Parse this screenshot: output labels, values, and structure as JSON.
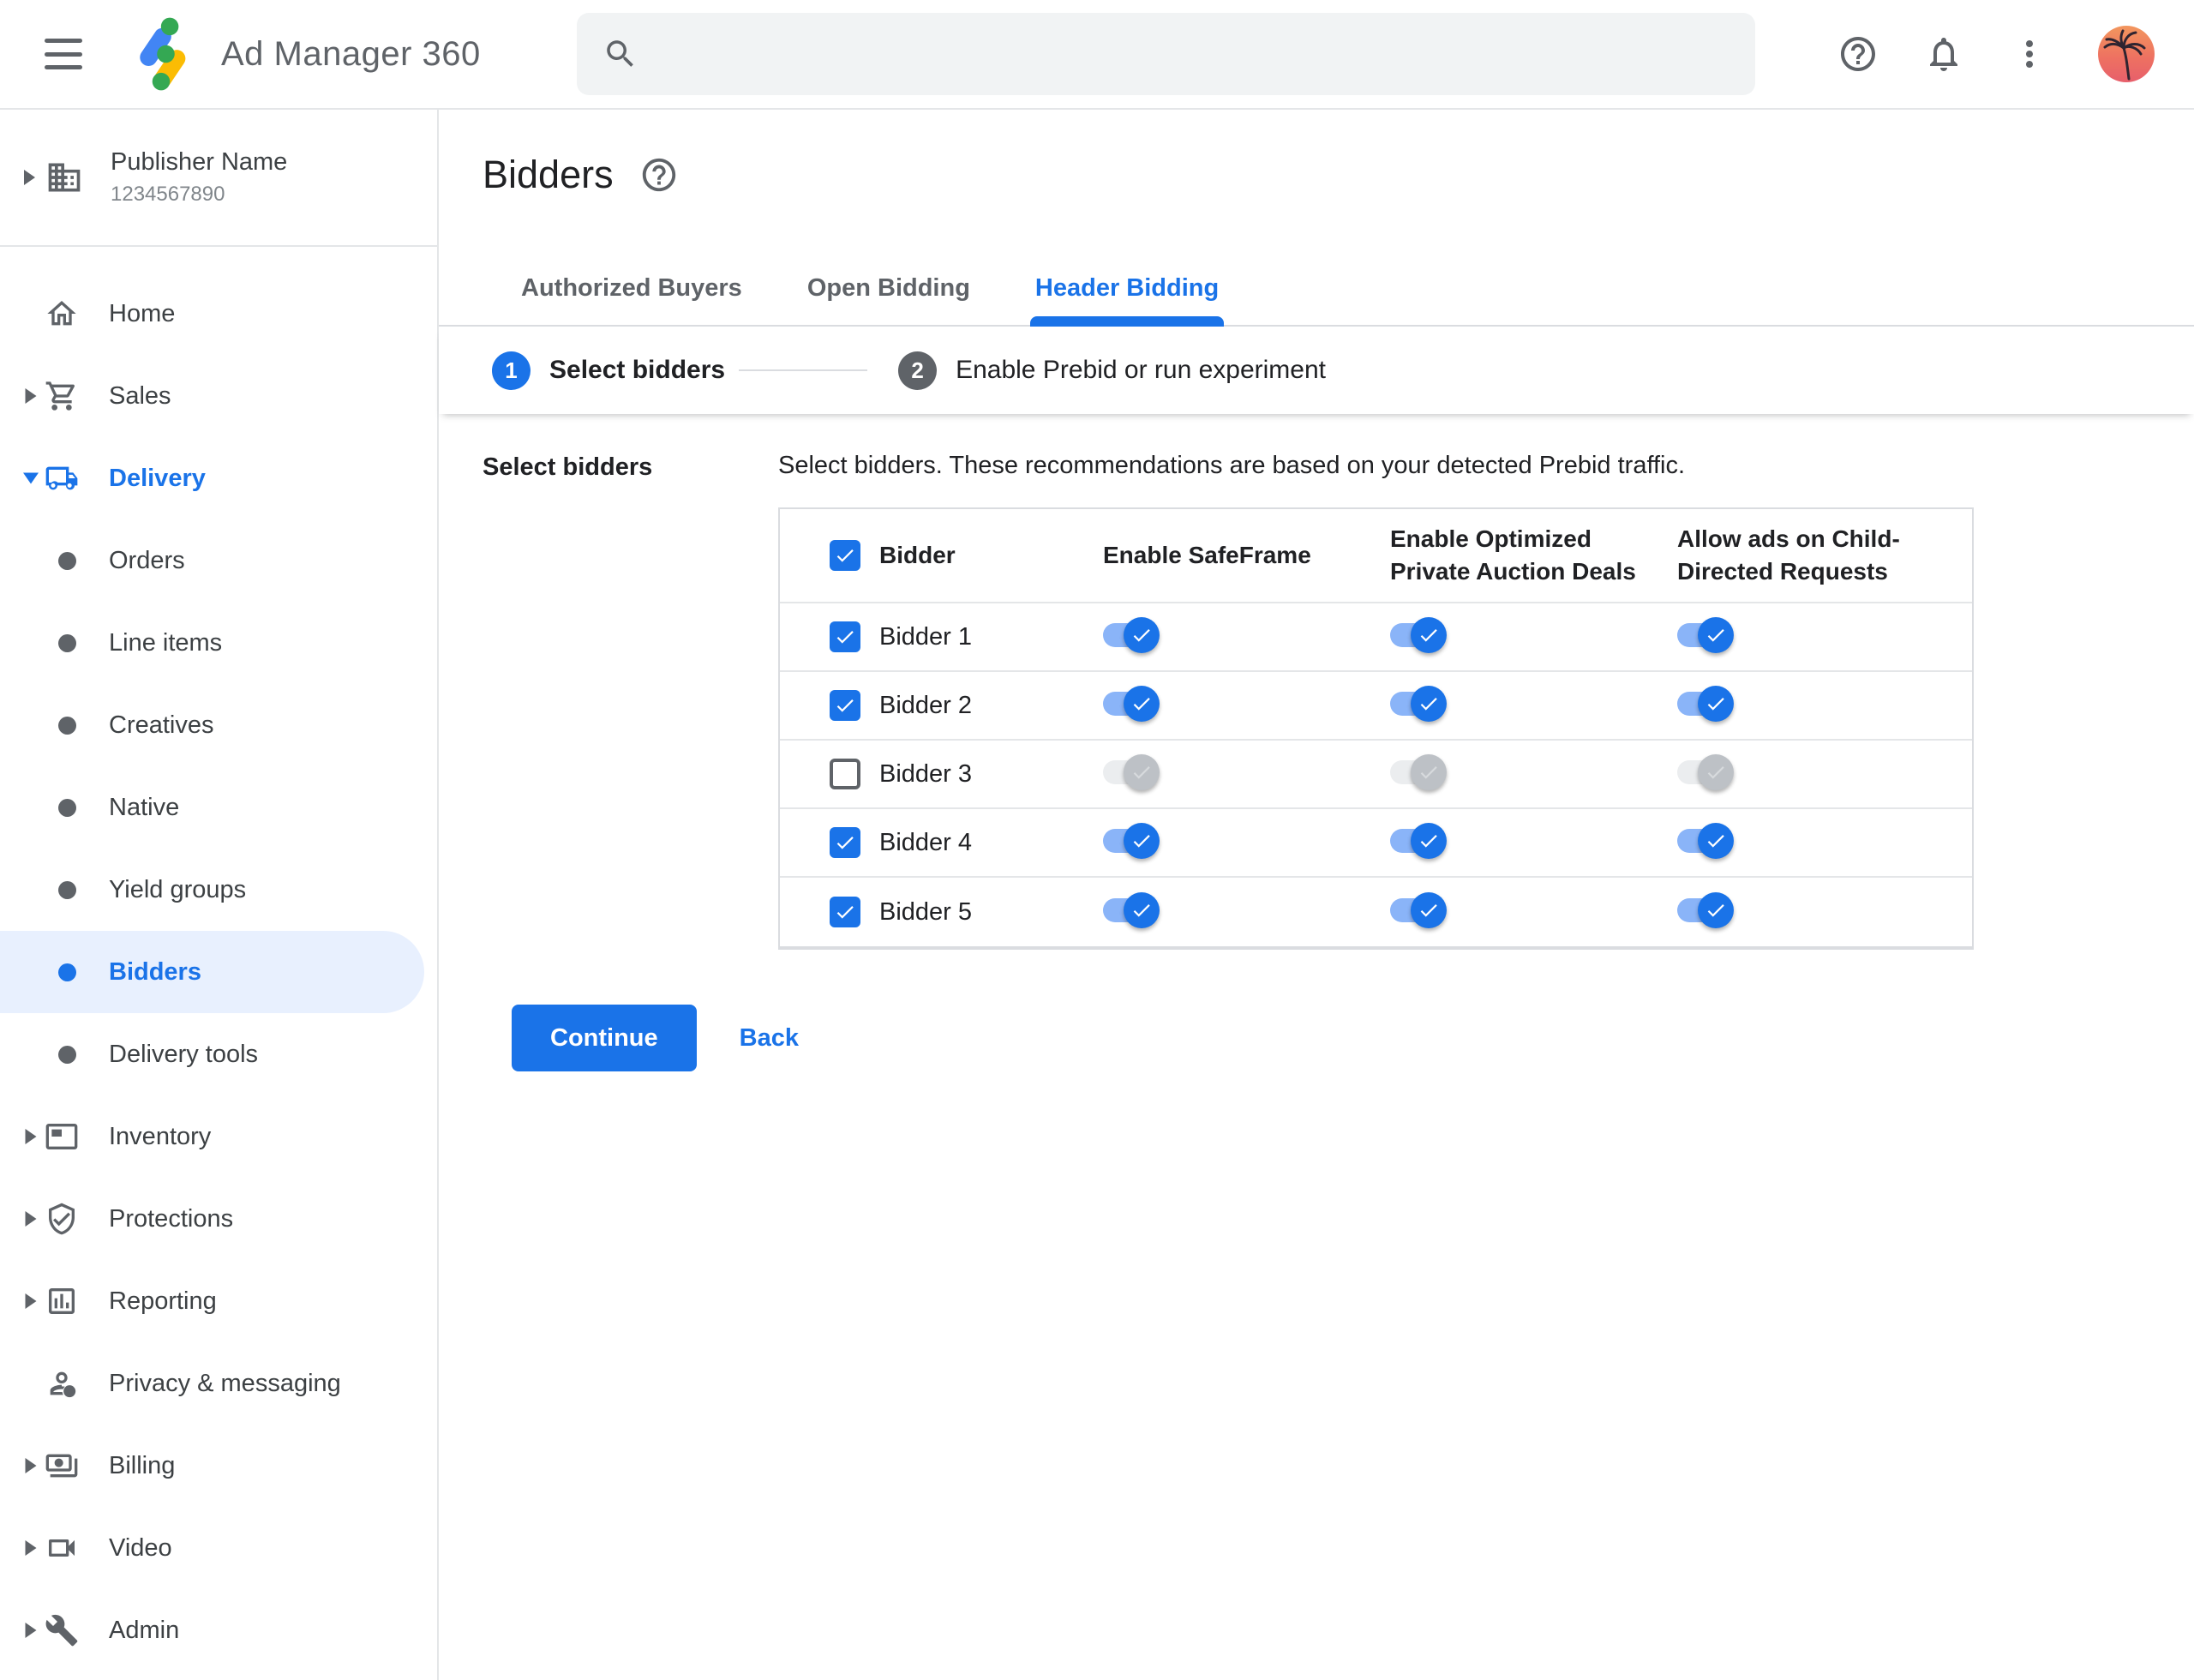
{
  "header": {
    "title": "Ad Manager 360",
    "search_value": "",
    "actions": [
      {
        "icon": "help",
        "label": "help"
      },
      {
        "icon": "notifications",
        "label": "notifications"
      },
      {
        "icon": "more-vert",
        "label": "more-options"
      }
    ],
    "avatar": {
      "icon": "palm-avatar"
    }
  },
  "sidebar": {
    "publisher": {
      "name": "Publisher Name",
      "id": "1234567890",
      "icon": "domain"
    },
    "items": [
      {
        "label": "Home",
        "icon": "home",
        "type": "top"
      },
      {
        "label": "Sales",
        "icon": "cart",
        "type": "top",
        "arrow_right": true
      },
      {
        "label": "Delivery",
        "icon": "truck",
        "type": "top",
        "arrow_down": true,
        "active": true
      },
      {
        "label": "Orders",
        "type": "sub"
      },
      {
        "label": "Line items",
        "type": "sub"
      },
      {
        "label": "Creatives",
        "type": "sub"
      },
      {
        "label": "Native",
        "type": "sub"
      },
      {
        "label": "Yield groups",
        "type": "sub"
      },
      {
        "label": "Bidders",
        "type": "sub",
        "selected": true
      },
      {
        "label": "Delivery tools",
        "type": "sub"
      },
      {
        "label": "Inventory",
        "icon": "inventory",
        "type": "top",
        "arrow_right": true
      },
      {
        "label": "Protections",
        "icon": "shield",
        "type": "top",
        "arrow_right": true
      },
      {
        "label": "Reporting",
        "icon": "reporting",
        "type": "top",
        "arrow_right": true
      },
      {
        "label": "Privacy & messaging",
        "icon": "privacy",
        "type": "top"
      },
      {
        "label": "Billing",
        "icon": "billing",
        "type": "top",
        "arrow_right": true
      },
      {
        "label": "Video",
        "icon": "video",
        "type": "top",
        "arrow_right": true
      },
      {
        "label": "Admin",
        "icon": "admin",
        "type": "top",
        "arrow_right": true
      }
    ]
  },
  "main": {
    "page_title": "Bidders",
    "tabs": [
      {
        "label": "Authorized Buyers",
        "active": false
      },
      {
        "label": "Open Bidding",
        "active": false
      },
      {
        "label": "Header Bidding",
        "active": true
      }
    ],
    "stepper": [
      {
        "number": "1",
        "label": "Select bidders",
        "active": true
      },
      {
        "number": "2",
        "label": "Enable Prebid or run experiment",
        "active": false
      }
    ],
    "section_label": "Select bidders",
    "description": "Select bidders. These recommendations are based on your detected Prebid traffic.",
    "table": {
      "header": {
        "bidder": "Bidder",
        "safeframe": "Enable SafeFrame",
        "optimized": "Enable Optimized Private Auction Deals",
        "child_directed": "Allow ads on Child-Directed Requests",
        "select_all_checked": true
      },
      "rows": [
        {
          "name": "Bidder 1",
          "checked": true,
          "safeframe": true,
          "optimized": true,
          "child_directed": true
        },
        {
          "name": "Bidder 2",
          "checked": true,
          "safeframe": true,
          "optimized": true,
          "child_directed": true
        },
        {
          "name": "Bidder 3",
          "checked": false,
          "safeframe": false,
          "optimized": false,
          "child_directed": false
        },
        {
          "name": "Bidder 4",
          "checked": true,
          "safeframe": true,
          "optimized": true,
          "child_directed": true
        },
        {
          "name": "Bidder 5",
          "checked": true,
          "safeframe": true,
          "optimized": true,
          "child_directed": true
        }
      ]
    },
    "continue_label": "Continue",
    "back_label": "Back"
  },
  "colors": {
    "accent": "#1a73e8",
    "logo_blue": "#4285f4",
    "logo_green": "#34a853",
    "logo_yellow": "#fbbc04",
    "selected_item_bg": "#e8f0fe",
    "toggle_on_track": "#8ab4f8",
    "toggle_off_track": "#ebedef",
    "toggle_off_thumb": "#bdc1c6"
  }
}
